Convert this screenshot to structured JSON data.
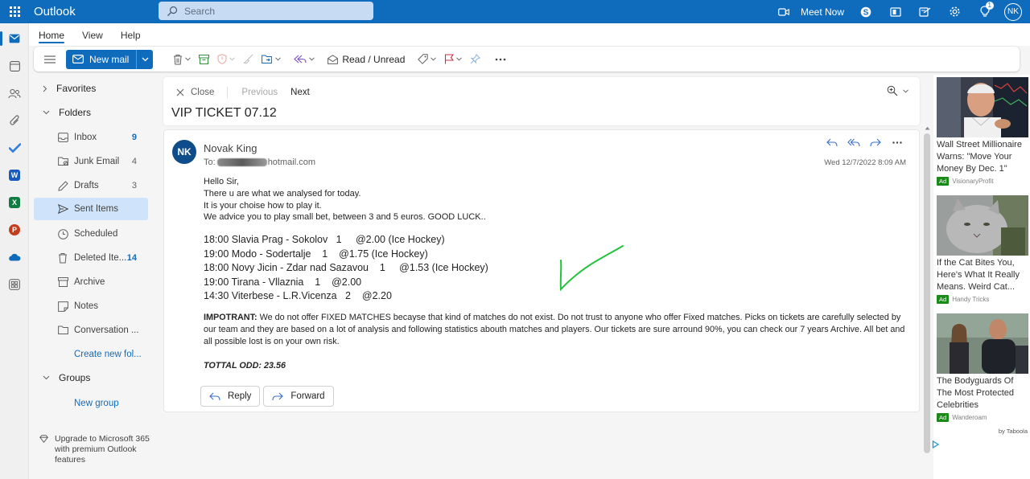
{
  "app": {
    "title": "Outlook"
  },
  "search": {
    "placeholder": "Search"
  },
  "header": {
    "meet_now": "Meet Now",
    "notif_count": "1",
    "avatar_initials": "NK"
  },
  "ribbon": {
    "tabs": [
      {
        "label": "Home"
      },
      {
        "label": "View"
      },
      {
        "label": "Help"
      }
    ],
    "new_mail": "New mail",
    "read_unread": "Read / Unread"
  },
  "folders": {
    "favorites": "Favorites",
    "folders_label": "Folders",
    "items": [
      {
        "label": "Inbox",
        "count": "9"
      },
      {
        "label": "Junk Email",
        "count": "4"
      },
      {
        "label": "Drafts",
        "count": "3"
      },
      {
        "label": "Sent Items",
        "count": ""
      },
      {
        "label": "Scheduled",
        "count": ""
      },
      {
        "label": "Deleted Ite...",
        "count": "14"
      },
      {
        "label": "Archive",
        "count": ""
      },
      {
        "label": "Notes",
        "count": ""
      },
      {
        "label": "Conversation ...",
        "count": ""
      }
    ],
    "create_new_folder": "Create new fol...",
    "groups": "Groups",
    "new_group": "New group",
    "upgrade": "Upgrade to Microsoft 365 with premium Outlook features"
  },
  "reading": {
    "close": "Close",
    "previous": "Previous",
    "next": "Next",
    "subject": "VIP TICKET 07.12"
  },
  "message": {
    "avatar_initials": "NK",
    "sender": "Novak King",
    "to_prefix": "To:",
    "to_domain": "hotmail.com",
    "date": "Wed 12/7/2022 8:09 AM",
    "greeting": "Hello Sir,",
    "lines": [
      "There u are what we analysed for today.",
      "It is your choise how to play it.",
      "We advice you to play small bet, between 3 and 5 euros. GOOD LUCK.."
    ],
    "picks": [
      "18:00 Slavia Prag - Sokolov   1     @2.00 (Ice Hockey)",
      "19:00 Modo - Sodertalje    1    @1.75 (Ice Hockey)",
      "18:00 Novy Jicin - Zdar nad Sazavou    1     @1.53 (Ice Hockey)",
      "19:00 Tirana - Vllaznia    1    @2.00",
      "14:30 Viterbese - L.R.Vicenza   2    @2.20"
    ],
    "disclaimer_label": "IMPOTRANT:",
    "disclaimer": " We do not offer FIXED MATCHES becayse that kind of matches do not exist. Do not trust to anyone who offer Fixed matches. Picks on tickets are carefully selected by our team and they are based on a lot of analysis and following statistics abouth matches and players. Our tickets are sure arround 90%, you can check our 7 years Archive. All bet and all possible lost is on your own risk.",
    "total_odd": "TOTTAL ODD: 23.56",
    "reply": "Reply",
    "forward": "Forward"
  },
  "ads": {
    "items": [
      {
        "title": "Wall Street Millionaire Warns: \"Move Your Money By Dec. 1\"",
        "source": "VisionaryProfit"
      },
      {
        "title": "If the Cat Bites You, Here's What It Really Means. Weird Cat...",
        "source": "Handy Tricks"
      },
      {
        "title": "The Bodyguards Of The Most Protected Celebrities",
        "source": "Wanderoam"
      }
    ],
    "ad_label": "Ad",
    "by_taboola": "by Taboola"
  },
  "colors": {
    "accent": "#0f6cbd",
    "selected": "#cfe4fa",
    "check": "#22c33a"
  }
}
